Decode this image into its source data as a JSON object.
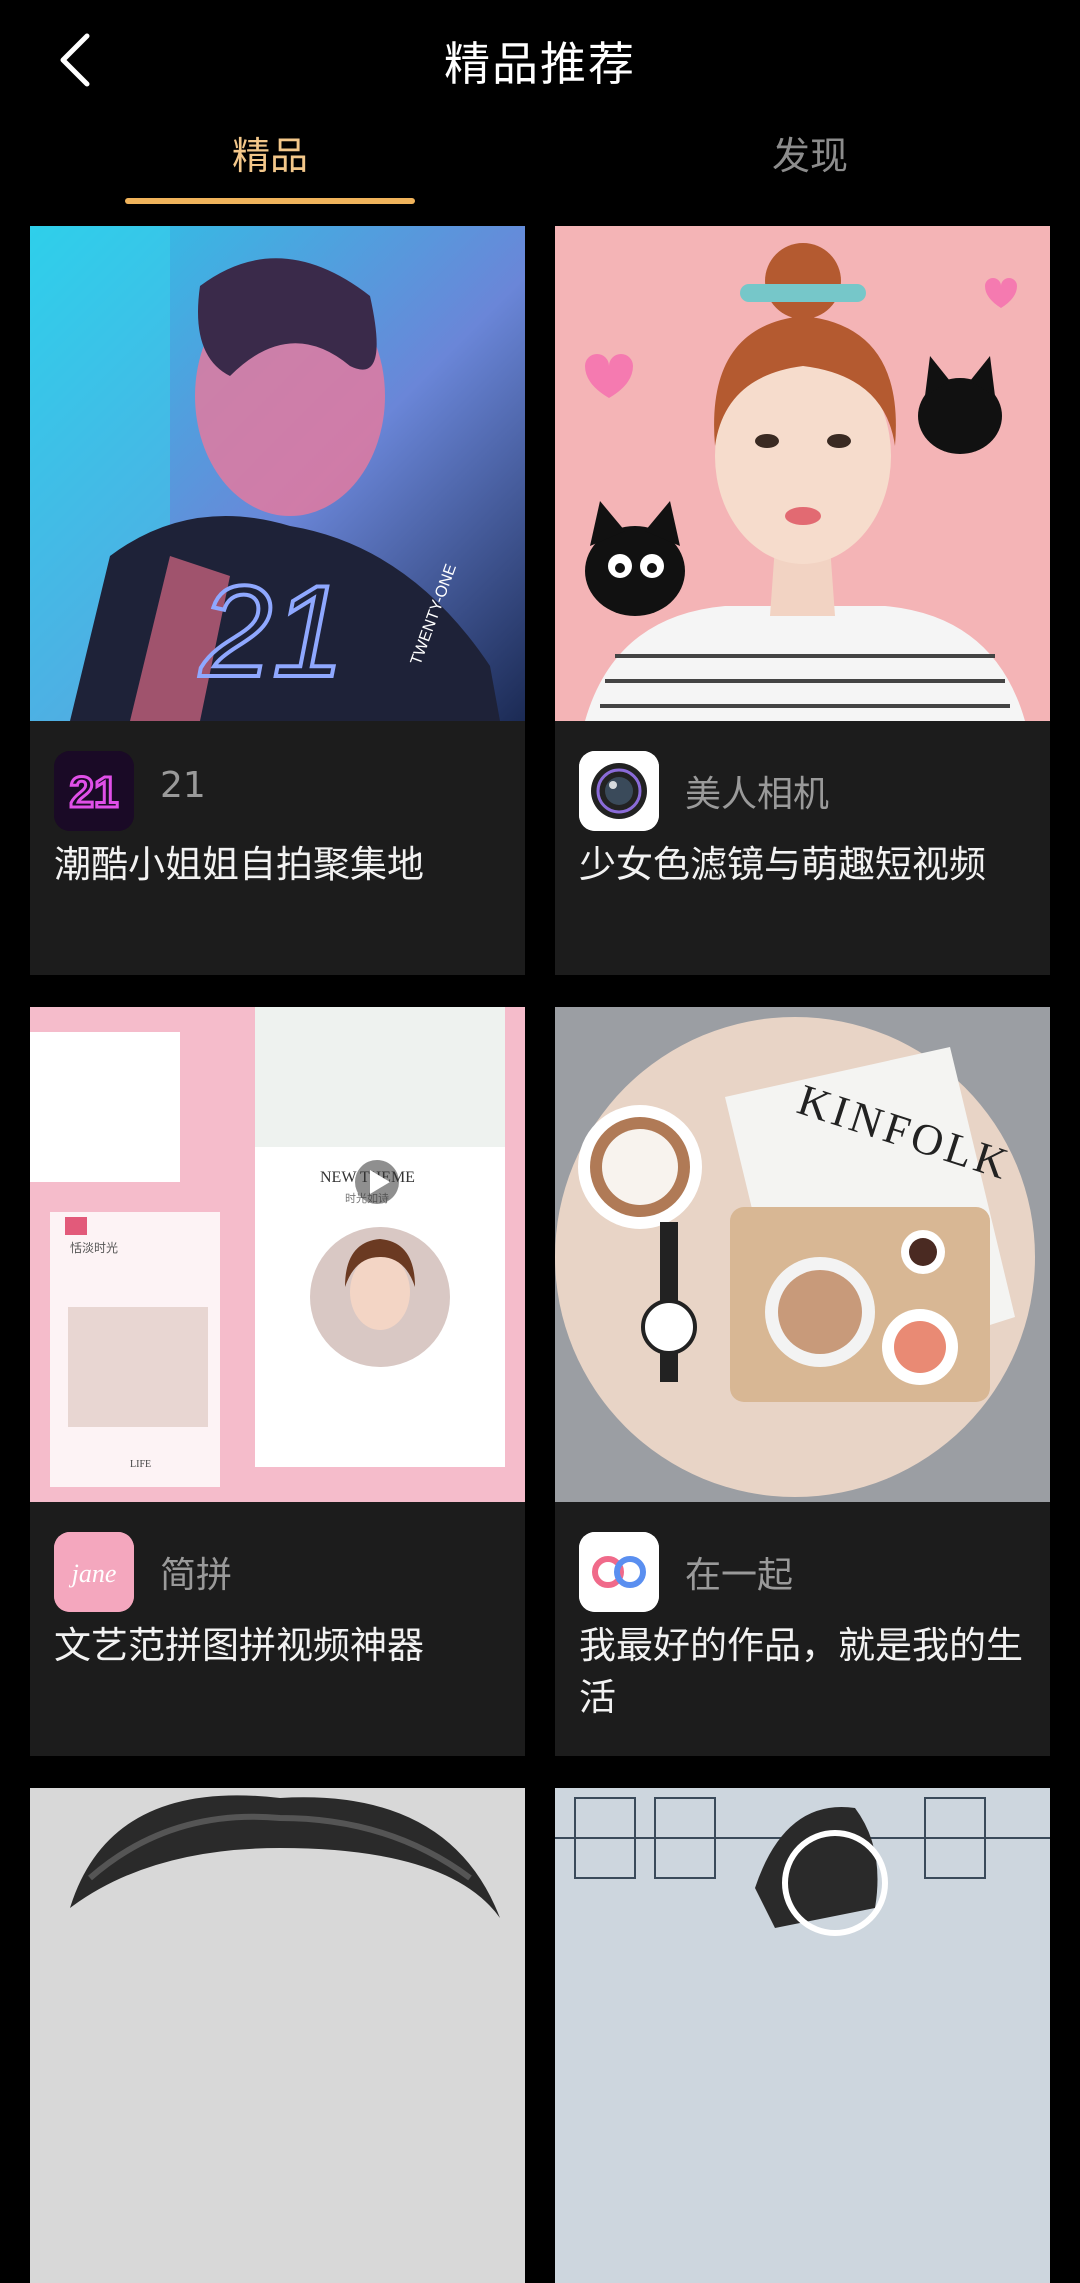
{
  "header": {
    "title": "精品推荐"
  },
  "tabs": [
    {
      "label": "精品",
      "active": true
    },
    {
      "label": "发现",
      "active": false
    }
  ],
  "colors": {
    "accent": "#f0b35b",
    "background": "#000000",
    "card": "#1c1c1c"
  },
  "cards": [
    {
      "app_name": "21",
      "desc": "潮酷小姐姐自拍聚集地",
      "icon": "21-app-icon"
    },
    {
      "app_name": "美人相机",
      "desc": "少女色滤镜与萌趣短视频",
      "icon": "camera-lens-icon"
    },
    {
      "app_name": "简拼",
      "desc": "文艺范拼图拼视频神器",
      "icon": "jane-script-icon"
    },
    {
      "app_name": "在一起",
      "desc": "我最好的作品，就是我的生活",
      "icon": "infinity-loop-icon"
    },
    {
      "app_name": "",
      "desc": ""
    },
    {
      "app_name": "",
      "desc": ""
    }
  ],
  "thumbs": {
    "card1": {
      "number_text": "21",
      "sleeve_text": "TWENTY-ONE"
    },
    "card3": {
      "theme_text": "NEW THEME",
      "sub_text": "时光如诗",
      "side_text": "恬淡时光",
      "label_text": "LIFE"
    },
    "card4": {
      "mag_text": "KINFOLK"
    }
  }
}
